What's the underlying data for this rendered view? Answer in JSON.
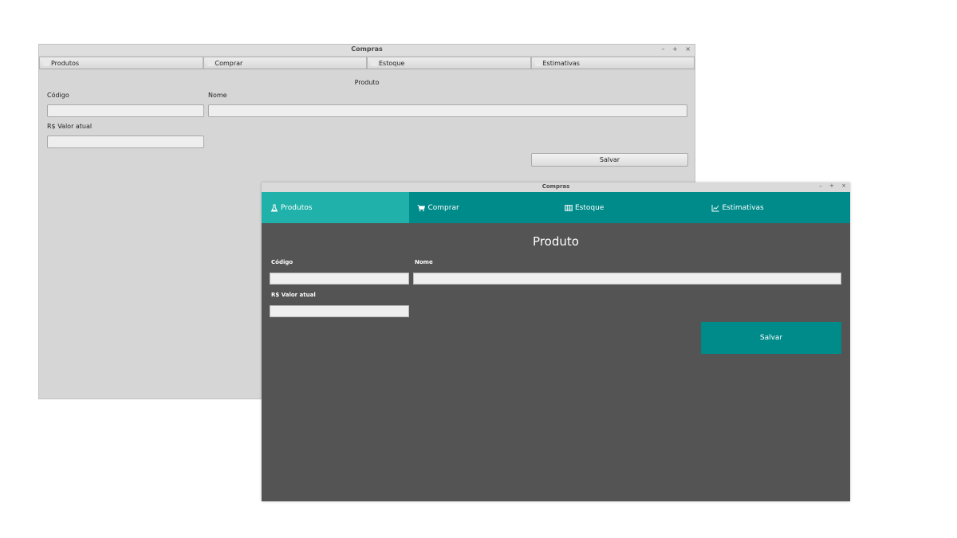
{
  "back_window": {
    "title": "Compras",
    "controls": {
      "minimize": "–",
      "maximize": "+",
      "close": "×"
    },
    "tabs": [
      {
        "label": "Produtos",
        "icon": "flask-icon"
      },
      {
        "label": "Comprar",
        "icon": "cart-icon"
      },
      {
        "label": "Estoque",
        "icon": "table-icon"
      },
      {
        "label": "Estimativas",
        "icon": "chart-icon"
      }
    ],
    "form": {
      "title": "Produto",
      "codigo_label": "Código",
      "codigo_value": "",
      "nome_label": "Nome",
      "nome_value": "",
      "valor_label": "R$ Valor atual",
      "valor_value": "",
      "save_label": "Salvar"
    }
  },
  "front_window": {
    "title": "Compras",
    "controls": {
      "minimize": "–",
      "maximize": "+",
      "close": "×"
    },
    "active_tab": 0,
    "tabs": [
      {
        "label": "Produtos",
        "icon": "flask-icon"
      },
      {
        "label": "Comprar",
        "icon": "cart-icon"
      },
      {
        "label": "Estoque",
        "icon": "table-icon"
      },
      {
        "label": "Estimativas",
        "icon": "line-chart-icon"
      }
    ],
    "form": {
      "title": "Produto",
      "codigo_label": "Código",
      "codigo_value": "",
      "nome_label": "Nome",
      "nome_value": "",
      "valor_label": "R$ Valor atual",
      "valor_value": "",
      "save_label": "Salvar"
    },
    "colors": {
      "accent": "#008b8b",
      "accent_active": "#20b2aa",
      "background": "#545454"
    }
  }
}
